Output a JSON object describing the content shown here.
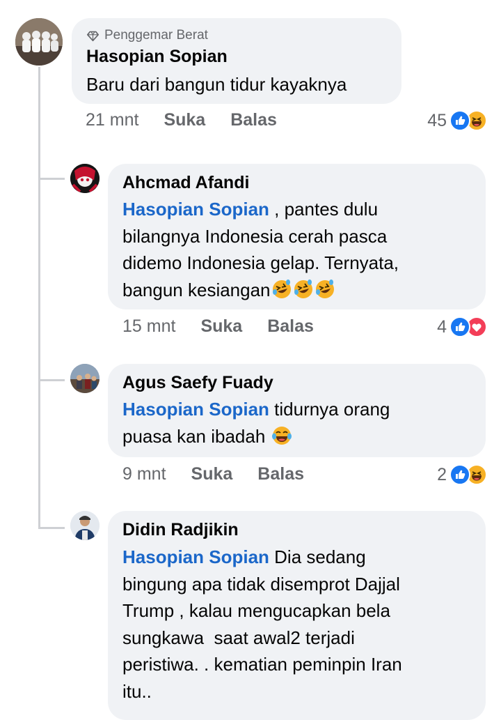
{
  "comments": [
    {
      "badge": "Penggemar Berat",
      "author": "Hasopian Sopian",
      "text": "Baru dari bangun tidur kayaknya",
      "time": "21 mnt",
      "like_label": "Suka",
      "reply_label": "Balas",
      "reaction_count": "45",
      "reactions": [
        "like-icon",
        "haha-icon"
      ]
    },
    {
      "author": "Ahcmad Afandi",
      "mention": "Hasopian Sopian",
      "line1_rest": " , pantes dulu",
      "line2": "bilangnya Indonesia cerah pasca",
      "line3": "didemo Indonesia gelap. Ternyata,",
      "line4": "bangun kesiangan",
      "emojis": [
        "rofl-emoji",
        "rofl-emoji",
        "rofl-emoji"
      ],
      "time": "15 mnt",
      "like_label": "Suka",
      "reply_label": "Balas",
      "reaction_count": "4",
      "reactions": [
        "like-icon",
        "love-icon"
      ]
    },
    {
      "author": "Agus Saefy Fuady",
      "mention": "Hasopian Sopian",
      "line1_rest": " tidurnya orang",
      "line2": "puasa kan ibadah ",
      "emojis": [
        "tears-of-joy-emoji"
      ],
      "time": "9 mnt",
      "like_label": "Suka",
      "reply_label": "Balas",
      "reaction_count": "2",
      "reactions": [
        "like-icon",
        "haha-icon"
      ]
    },
    {
      "author": "Didin Radjikin",
      "mention": "Hasopian Sopian",
      "line1_rest": " Dia sedang",
      "line2": "bingung apa tidak disemprot Dajjal",
      "line3": "Trump , kalau mengucapkan bela",
      "line4": "sungkawa  saat awal2 terjadi",
      "line5": "peristiwa. . kematian peminpin Iran",
      "line6": "itu.."
    }
  ],
  "colors": {
    "bubble": "#f0f2f5",
    "mention": "#1b67c9",
    "meta": "#65676b",
    "like": "#1877f2",
    "love": "#f33e58",
    "haha": "#f7b125"
  }
}
